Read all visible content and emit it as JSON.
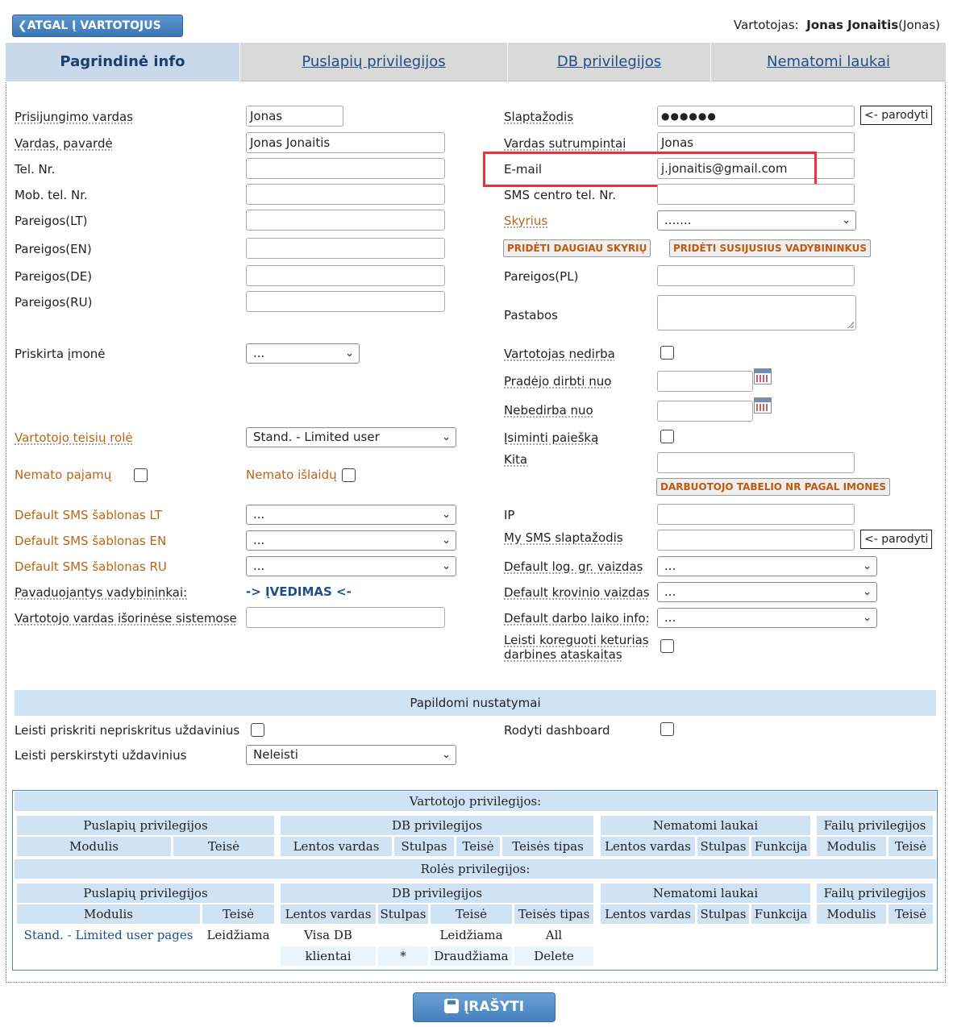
{
  "header": {
    "back_button": "❮ATGAL Į VARTOTOJUS",
    "user_label": "Vartotojas:",
    "user_name": "Jonas Jonaitis",
    "user_login": "(Jonas)"
  },
  "tabs": [
    "Pagrindinė info",
    "Puslapių privilegijos",
    "DB privilegijos",
    "Nematomi laukai"
  ],
  "left": {
    "login_label": "Prisijungimo vardas",
    "login_value": "Jonas",
    "fullname_label": "Vardas, pavardė",
    "fullname_value": "Jonas Jonaitis",
    "tel_label": "Tel. Nr.",
    "mob_label": "Mob. tel. Nr.",
    "pos_lt_label": "Pareigos(LT)",
    "pos_en_label": "Pareigos(EN)",
    "pos_de_label": "Pareigos(DE)",
    "pos_ru_label": "Pareigos(RU)",
    "company_label": "Priskirta įmonė",
    "company_value": "...",
    "role_label": "Vartotojo teisių rolė",
    "role_value": "Stand. - Limited user",
    "no_income_label": "Nemato pajamų",
    "no_expense_label": "Nemato išlaidų",
    "sms_lt_label": "Default SMS šablonas LT",
    "sms_lt_value": "...",
    "sms_en_label": "Default SMS šablonas EN",
    "sms_en_value": "...",
    "sms_ru_label": "Default SMS šablonas RU",
    "sms_ru_value": "...",
    "deputy_label": "Pavaduojantys vadybininkai:",
    "deputy_link": "-> ĮVEDIMAS <-",
    "external_label": "Vartotojo vardas išorinėse sistemose"
  },
  "right": {
    "password_label": "Slaptažodis",
    "password_value": "●●●●●●",
    "show_label": "<- parodyti",
    "short_label": "Vardas sutrumpintai",
    "short_value": "Jonas",
    "email_label": "E-mail",
    "email_value": "j.jonaitis@gmail.com",
    "sms_center_label": "SMS centro tel. Nr.",
    "dept_label": "Skyrius",
    "dept_value": ".......",
    "add_dept_button": "PRIDĖTI DAUGIAU SKYRIŲ",
    "add_managers_button": "PRIDĖTI SUSIJUSIUS VADYBININKUS",
    "pos_pl_label": "Pareigos(PL)",
    "notes_label": "Pastabos",
    "not_working_label": "Vartotojas nedirba",
    "start_label": "Pradėjo dirbti nuo",
    "end_label": "Nebedirba nuo",
    "remember_label": "Įsiminti paiešką",
    "other_label": "Kita",
    "tabel_button": "DARBUOTOJO TABELIO NR PAGAL IMONES",
    "ip_label": "IP",
    "mysms_label": "My SMS slaptažodis",
    "mysms_show": "<- parodyti",
    "log_view_label": "Default log. gr. vaizdas",
    "log_view_value": "...",
    "cargo_view_label": "Default krovinio vaizdas",
    "cargo_view_value": "...",
    "worktime_label": "Default darbo laiko info:",
    "worktime_value": "...",
    "four_reports_label_1": "Leisti koreguoti keturias",
    "four_reports_label_2": "darbines ataskaitas"
  },
  "extra": {
    "title": "Papildomi nustatymai",
    "assign_label": "Leisti priskriti nepriskritus uždavinius",
    "dashboard_label": "Rodyti dashboard",
    "reassign_label": "Leisti perskirstyti uždavinius",
    "reassign_value": "Neleisti"
  },
  "privileges": {
    "user_title": "Vartotojo privilegijos:",
    "role_title": "Rolės privilegijos:",
    "groups": [
      "Puslapių privilegijos",
      "DB privilegijos",
      "Nematomi laukai",
      "Failų privilegijos"
    ],
    "page_cols": [
      "Modulis",
      "Teisė"
    ],
    "db_cols": [
      "Lentos vardas",
      "Stulpas",
      "Teisė",
      "Teisės tipas"
    ],
    "hidden_cols": [
      "Lentos vardas",
      "Stulpas",
      "Funkcija"
    ],
    "file_cols": [
      "Modulis",
      "Teisė"
    ],
    "role_page_rows": [
      [
        "Stand. - Limited user pages",
        "Leidžiama"
      ]
    ],
    "role_db_rows": [
      [
        "Visa DB",
        "",
        "Leidžiama",
        "All"
      ],
      [
        "klientai",
        "*",
        "Draudžiama",
        "Delete"
      ]
    ]
  },
  "save_button": "ĮRAŠYTI"
}
